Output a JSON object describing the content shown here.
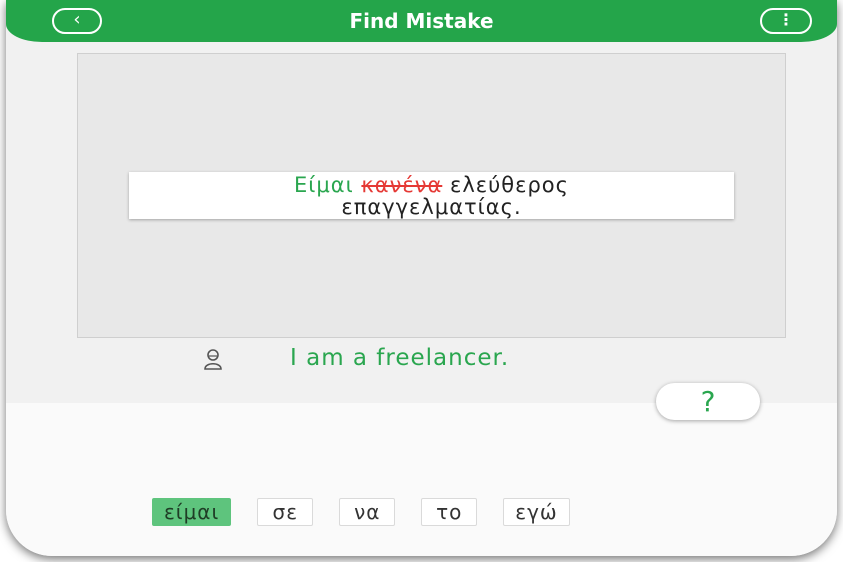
{
  "header": {
    "title": "Find Mistake",
    "back_icon": "chevron-left-icon",
    "menu_icon": "more-vertical-icon"
  },
  "exercise": {
    "sentence_line1_correct": "Είμαι",
    "sentence_line1_wrong": "κανένα",
    "sentence_line1_rest": "ελεύθερος",
    "sentence_line2": "επαγγελματίας.",
    "translation": "I am a freelancer.",
    "speaker_icon": "person-speaking-icon"
  },
  "help_button": {
    "label": "?"
  },
  "options": [
    {
      "label": "είμαι",
      "selected": true
    },
    {
      "label": "σε",
      "selected": false
    },
    {
      "label": "να",
      "selected": false
    },
    {
      "label": "το",
      "selected": false
    },
    {
      "label": "εγώ",
      "selected": false
    }
  ],
  "colors": {
    "accent": "#24a54a",
    "correct": "#2aa64f",
    "wrong": "#e53935",
    "selected_chip": "#5ec47d"
  }
}
